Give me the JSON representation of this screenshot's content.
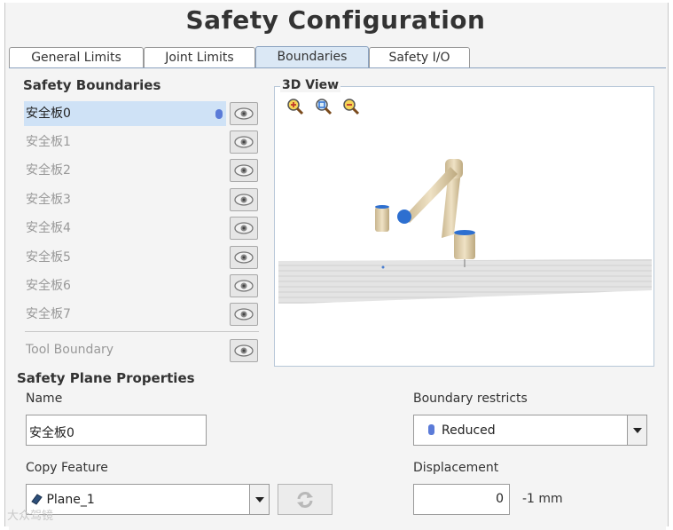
{
  "window": {
    "title": "Safety Configuration"
  },
  "tabs": [
    {
      "label": "General Limits",
      "active": false
    },
    {
      "label": "Joint Limits",
      "active": false
    },
    {
      "label": "Boundaries",
      "active": true
    },
    {
      "label": "Safety I/O",
      "active": false
    }
  ],
  "boundaries": {
    "heading": "Safety Boundaries",
    "items": [
      {
        "label": "安全板0",
        "selected": true,
        "icon": "eye-icon"
      },
      {
        "label": "安全板1",
        "selected": false,
        "icon": "eye-icon"
      },
      {
        "label": "安全板2",
        "selected": false,
        "icon": "eye-icon"
      },
      {
        "label": "安全板3",
        "selected": false,
        "icon": "eye-icon"
      },
      {
        "label": "安全板4",
        "selected": false,
        "icon": "eye-icon"
      },
      {
        "label": "安全板5",
        "selected": false,
        "icon": "eye-icon"
      },
      {
        "label": "安全板6",
        "selected": false,
        "icon": "eye-icon"
      },
      {
        "label": "安全板7",
        "selected": false,
        "icon": "eye-icon"
      }
    ],
    "tool_boundary": "Tool Boundary"
  },
  "view3d": {
    "label": "3D View",
    "zoom_icons": [
      "zoom-in-icon",
      "zoom-reset-icon",
      "zoom-out-icon"
    ]
  },
  "plane_properties": {
    "heading": "Safety Plane Properties",
    "name_label": "Name",
    "name_value": "安全板0",
    "copy_feature_label": "Copy Feature",
    "copy_feature_value": "Plane_1",
    "boundary_restricts_label": "Boundary restricts",
    "boundary_restricts_value": "Reduced",
    "displacement_label": "Displacement",
    "displacement_value": "0",
    "displacement_unit": "-1 mm"
  },
  "watermark": "大众驾镜",
  "colors": {
    "selected_row": "#cfe2f6",
    "active_tab": "#dbe8f5",
    "reduced_dot": "#5b7bd8"
  }
}
